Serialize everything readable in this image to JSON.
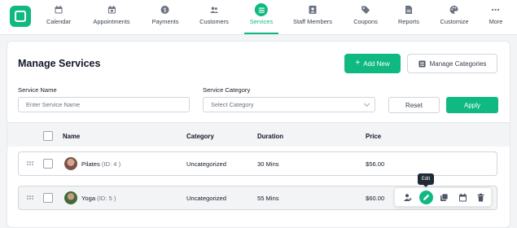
{
  "nav": {
    "items": [
      {
        "label": "Calendar",
        "icon": "calendar-icon"
      },
      {
        "label": "Appointments",
        "icon": "calendar-check-icon"
      },
      {
        "label": "Payments",
        "icon": "dollar-icon"
      },
      {
        "label": "Customers",
        "icon": "users-icon"
      },
      {
        "label": "Services",
        "icon": "list-icon"
      },
      {
        "label": "Staff Members",
        "icon": "id-card-icon"
      },
      {
        "label": "Coupons",
        "icon": "tag-icon"
      },
      {
        "label": "Reports",
        "icon": "report-icon"
      },
      {
        "label": "Customize",
        "icon": "palette-icon"
      },
      {
        "label": "More",
        "icon": "dots-icon"
      }
    ],
    "active": "Services",
    "accent": "#10b981"
  },
  "page": {
    "title": "Manage Services",
    "add_label": "Add New",
    "categories_label": "Manage Categories"
  },
  "filters": {
    "name_label": "Service Name",
    "name_placeholder": "Enter Service Name",
    "category_label": "Service Category",
    "category_value": "Select Category",
    "reset_label": "Reset",
    "apply_label": "Apply"
  },
  "table": {
    "columns": [
      "Name",
      "Category",
      "Duration",
      "Price"
    ],
    "rows": [
      {
        "name": "Pilates",
        "id": "(ID: 4 )",
        "category": "Uncategorized",
        "duration": "30 Mins",
        "price": "$56.00"
      },
      {
        "name": "Yoga",
        "id": "(ID: 5 )",
        "category": "Uncategorized",
        "duration": "55 Mins",
        "price": "$60.00"
      }
    ]
  },
  "tooltip": "Edit"
}
